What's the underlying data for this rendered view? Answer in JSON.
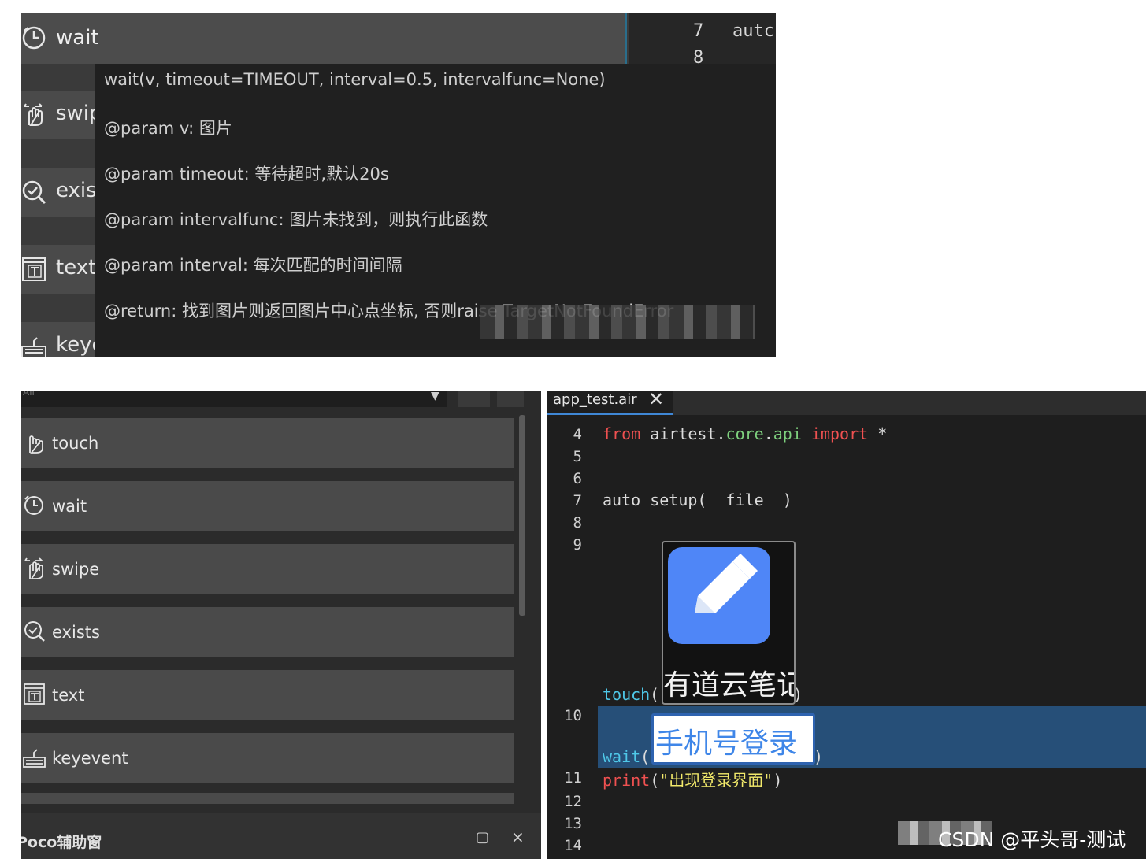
{
  "top_panel": {
    "wait_label": "wait",
    "rows": [
      "swip",
      "exis",
      "text",
      "keye"
    ],
    "line_numbers": [
      "7",
      "8"
    ],
    "code_fragment": "autc",
    "tooltip": {
      "signature": "wait(v, timeout=TIMEOUT, interval=0.5, intervalfunc=None)",
      "param_v": "@param v: 图片",
      "param_timeout": "@param timeout: 等待超时,默认20s",
      "param_intervalfunc": "@param intervalfunc: 图片未找到，则执行此函数",
      "param_interval": "@param interval: 每次匹配的时间间隔",
      "return": "@return: 找到图片则返回图片中心点坐标, 否则raise TargetNotFoundError"
    }
  },
  "sidebar": {
    "search_placeholder": "All",
    "items": [
      "touch",
      "wait",
      "swipe",
      "exists",
      "text",
      "keyevent"
    ]
  },
  "poco": {
    "title": "Poco辅助窗",
    "restore": "▢",
    "close": "×"
  },
  "editor": {
    "tab_label": "app_test.air",
    "tab_close": "✕",
    "lines": [
      {
        "n": "4",
        "parts": [
          [
            "kw",
            "from"
          ],
          [
            "p",
            " airtest."
          ],
          [
            "mod",
            "core"
          ],
          [
            "p",
            "."
          ],
          [
            "mod",
            "api"
          ],
          [
            "p",
            " "
          ],
          [
            "kw",
            "import"
          ],
          [
            "p",
            " *"
          ]
        ]
      },
      {
        "n": "5",
        "parts": []
      },
      {
        "n": "6",
        "parts": []
      },
      {
        "n": "7",
        "parts": [
          [
            "p",
            "auto_setup(__file__)"
          ]
        ]
      },
      {
        "n": "8",
        "parts": []
      },
      {
        "n": "9",
        "parts": []
      },
      {
        "n": "10",
        "parts": []
      },
      {
        "n": "11",
        "parts": [
          [
            "kw",
            "print"
          ],
          [
            "p",
            "("
          ],
          [
            "str",
            "\"出现登录界面\""
          ],
          [
            "p",
            ")"
          ]
        ]
      },
      {
        "n": "12",
        "parts": []
      },
      {
        "n": "13",
        "parts": []
      },
      {
        "n": "14",
        "parts": []
      }
    ],
    "touch_fn": "touch",
    "wait_fn": "wait",
    "open_paren": "(",
    "close_paren": ")",
    "image_note_text": "有道云笔记",
    "image_login_text": "手机号登录"
  },
  "watermark": "CSDN @平头哥-测试",
  "colors": {
    "keyword": "#f05151",
    "module": "#7ed17e",
    "function": "#4fc8e8",
    "string": "#f3ea6b",
    "highlight": "#264f78",
    "note_app_blue": "#4f86f7"
  }
}
